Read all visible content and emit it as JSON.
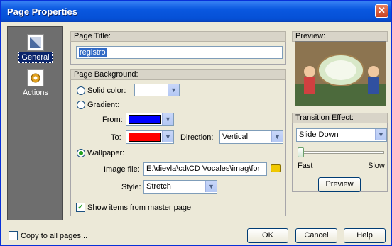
{
  "window": {
    "title": "Page Properties"
  },
  "sidebar": {
    "items": [
      {
        "label": "General",
        "icon": "page-icon"
      },
      {
        "label": "Actions",
        "icon": "gear-icon"
      }
    ]
  },
  "page_title": {
    "label": "Page Title:",
    "value": "registro"
  },
  "background": {
    "label": "Page Background:",
    "solid_color_label": "Solid color:",
    "gradient_label": "Gradient:",
    "from_label": "From:",
    "from_color": "#0000ff",
    "to_label": "To:",
    "to_color": "#ff0000",
    "direction_label": "Direction:",
    "direction_value": "Vertical",
    "wallpaper_label": "Wallpaper:",
    "image_file_label": "Image file:",
    "image_file_value": "E:\\dievla\\cd\\CD Vocales\\imag\\for",
    "style_label": "Style:",
    "style_value": "Stretch"
  },
  "show_master": {
    "label": "Show items from master page",
    "checked": true
  },
  "preview": {
    "label": "Preview:"
  },
  "transition": {
    "label": "Transition Effect:",
    "value": "Slide Down",
    "fast_label": "Fast",
    "slow_label": "Slow",
    "preview_button": "Preview"
  },
  "footer": {
    "copy_all_label": "Copy to all pages...",
    "ok": "OK",
    "cancel": "Cancel",
    "help": "Help"
  },
  "colors": {
    "accent": "#316ac5",
    "titlebar": "#0550d6",
    "sidebar": "#6e6e6e"
  }
}
